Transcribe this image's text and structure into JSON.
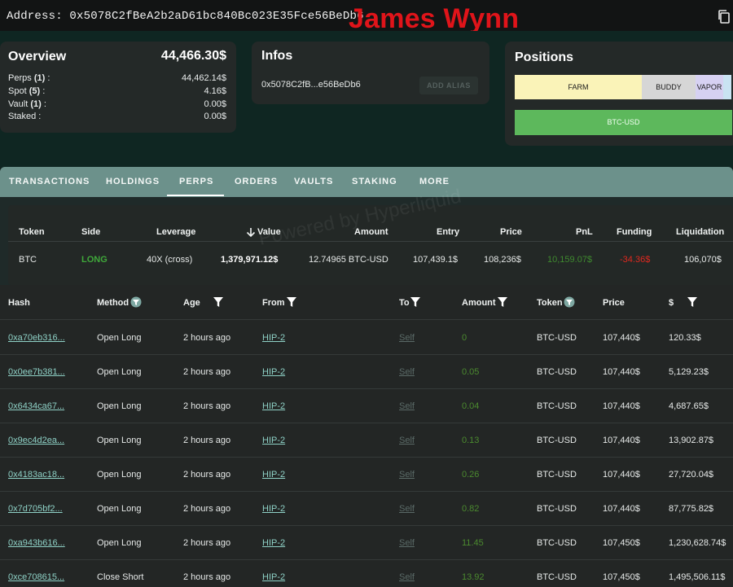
{
  "header": {
    "address_label": "Address: 0x5078C2fBeA2b2aD61bc840Bc023E35Fce56BeDb6",
    "overlay_title": "James Wynn"
  },
  "overview": {
    "title": "Overview",
    "total": "44,466.30$",
    "rows": [
      {
        "label": "Perps",
        "count": "(1)",
        "suffix": " :",
        "value": "44,462.14$"
      },
      {
        "label": "Spot",
        "count": "(5)",
        "suffix": " :",
        "value": "4.16$"
      },
      {
        "label": "Vault",
        "count": "(1)",
        "suffix": " :",
        "value": "0.00$"
      },
      {
        "label": "Staked",
        "count": "",
        "suffix": " :",
        "value": "0.00$"
      }
    ]
  },
  "infos": {
    "title": "Infos",
    "short_address": "0x5078C2fB...e56BeDb6",
    "alias_button": "ADD ALIAS"
  },
  "positions": {
    "title": "Positions",
    "blocks": [
      "FARM",
      "BUDDY",
      "VAPOR",
      ""
    ],
    "main": "BTC-USD",
    "colors": {
      "farm": "#faf3b8",
      "buddy": "#d6d6d6",
      "vapor": "#d6d1f2",
      "btc": "#5db85c"
    }
  },
  "tabs": [
    "TRANSACTIONS",
    "HOLDINGS",
    "PERPS",
    "ORDERS",
    "VAULTS",
    "STAKING",
    "MORE"
  ],
  "active_tab": "PERPS",
  "perps": {
    "headers": [
      "Token",
      "Side",
      "Leverage",
      "Value",
      "Amount",
      "Entry",
      "Price",
      "PnL",
      "Funding",
      "Liquidation"
    ],
    "row": {
      "token": "BTC",
      "side": "LONG",
      "leverage": "40X (cross)",
      "value": "1,379,971.12$",
      "amount": "12.74965 BTC-USD",
      "entry": "107,439.1$",
      "price": "108,236$",
      "pnl": "10,159.07$",
      "funding": "-34.36$",
      "liquidation": "106,070$"
    },
    "watermark": "Powered by Hyperliquid",
    "colors": {
      "long": "#3fa83a",
      "pnl": "#3f8a2f",
      "funding": "#e0281f"
    }
  },
  "transactions": {
    "headers": [
      "Hash",
      "Method",
      "Age",
      "From",
      "To",
      "Amount",
      "Token",
      "Price",
      "$"
    ],
    "rows": [
      {
        "hash": "0xa70eb316...",
        "method": "Open Long",
        "age": "2 hours ago",
        "from": "HIP-2",
        "to": "Self",
        "amount": "0",
        "token": "BTC-USD",
        "price": "107,440$",
        "usd": "120.33$"
      },
      {
        "hash": "0x0ee7b381...",
        "method": "Open Long",
        "age": "2 hours ago",
        "from": "HIP-2",
        "to": "Self",
        "amount": "0.05",
        "token": "BTC-USD",
        "price": "107,440$",
        "usd": "5,129.23$"
      },
      {
        "hash": "0x6434ca67...",
        "method": "Open Long",
        "age": "2 hours ago",
        "from": "HIP-2",
        "to": "Self",
        "amount": "0.04",
        "token": "BTC-USD",
        "price": "107,440$",
        "usd": "4,687.65$"
      },
      {
        "hash": "0x9ec4d2ea...",
        "method": "Open Long",
        "age": "2 hours ago",
        "from": "HIP-2",
        "to": "Self",
        "amount": "0.13",
        "token": "BTC-USD",
        "price": "107,440$",
        "usd": "13,902.87$"
      },
      {
        "hash": "0x4183ac18...",
        "method": "Open Long",
        "age": "2 hours ago",
        "from": "HIP-2",
        "to": "Self",
        "amount": "0.26",
        "token": "BTC-USD",
        "price": "107,440$",
        "usd": "27,720.04$"
      },
      {
        "hash": "0x7d705bf2...",
        "method": "Open Long",
        "age": "2 hours ago",
        "from": "HIP-2",
        "to": "Self",
        "amount": "0.82",
        "token": "BTC-USD",
        "price": "107,440$",
        "usd": "87,775.82$"
      },
      {
        "hash": "0xa943b616...",
        "method": "Open Long",
        "age": "2 hours ago",
        "from": "HIP-2",
        "to": "Self",
        "amount": "11.45",
        "token": "BTC-USD",
        "price": "107,450$",
        "usd": "1,230,628.74$"
      },
      {
        "hash": "0xce708615...",
        "method": "Close Short",
        "age": "2 hours ago",
        "from": "HIP-2",
        "to": "Self",
        "amount": "13.92",
        "token": "BTC-USD",
        "price": "107,450$",
        "usd": "1,495,506.11$"
      }
    ]
  },
  "icons": {
    "copy": "copy-icon",
    "sort": "arrow-down-icon",
    "filter": "filter-icon"
  }
}
